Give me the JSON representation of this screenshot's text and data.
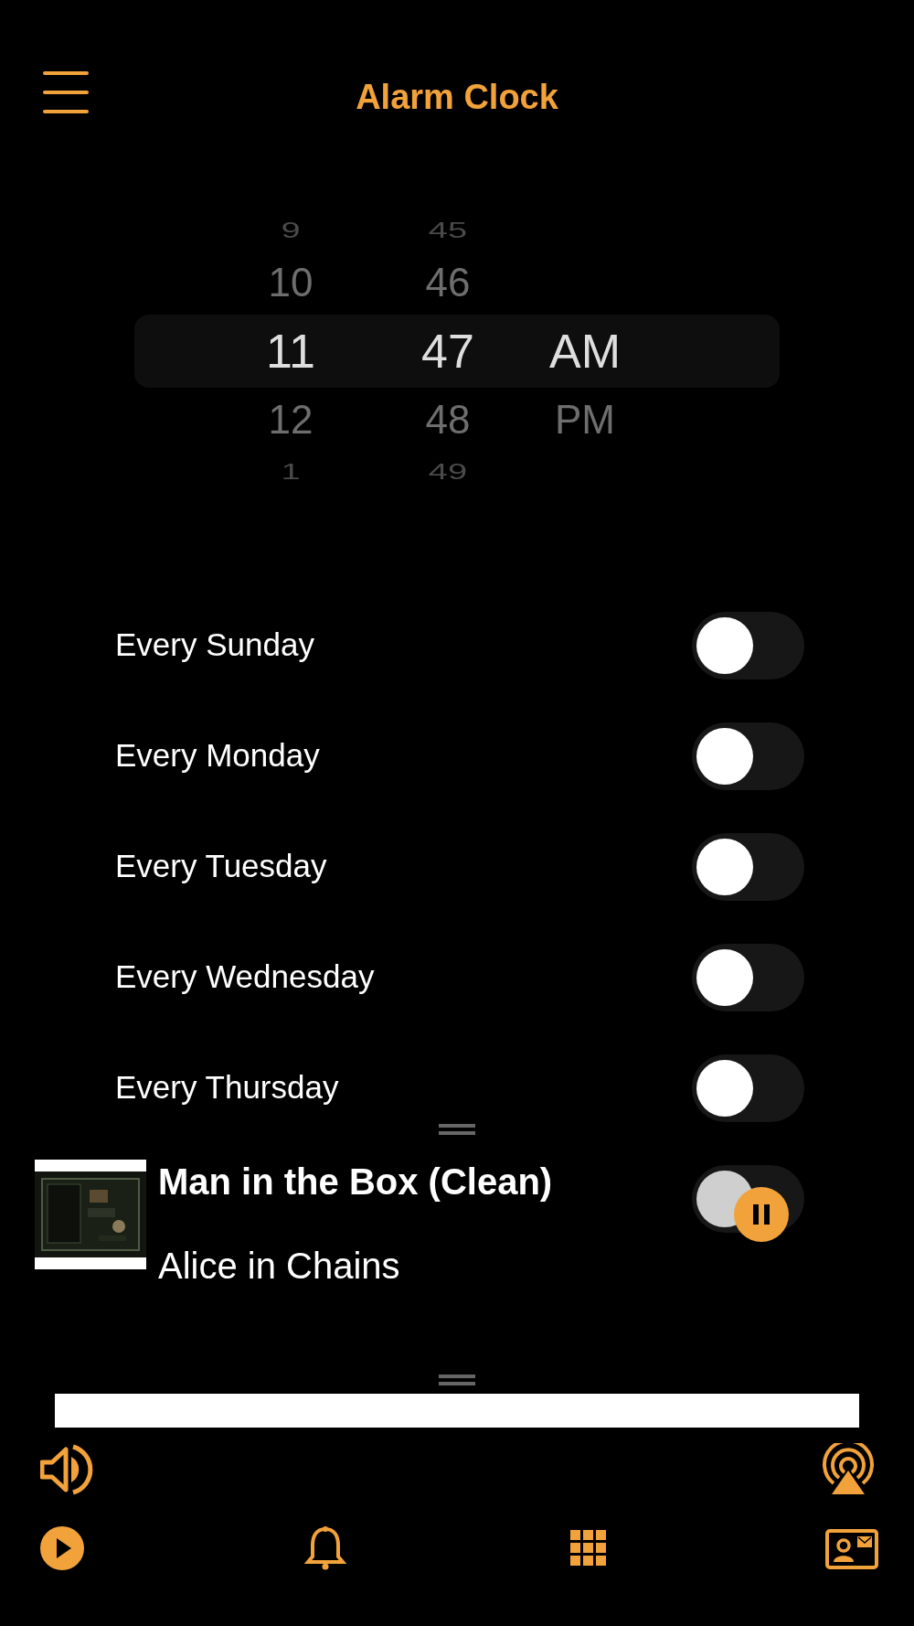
{
  "header": {
    "title": "Alarm Clock"
  },
  "picker": {
    "columns": [
      {
        "items": [
          {
            "text": "9",
            "selected": false
          },
          {
            "text": "10",
            "selected": false
          },
          {
            "text": "11",
            "selected": true
          },
          {
            "text": "12",
            "selected": false
          },
          {
            "text": "1",
            "selected": false
          }
        ]
      },
      {
        "items": [
          {
            "text": "45",
            "selected": false
          },
          {
            "text": "46",
            "selected": false
          },
          {
            "text": "47",
            "selected": true
          },
          {
            "text": "48",
            "selected": false
          },
          {
            "text": "49",
            "selected": false
          }
        ]
      },
      {
        "items": [
          {
            "text": "AM",
            "selected": true
          },
          {
            "text": "PM",
            "selected": false
          }
        ]
      }
    ]
  },
  "repeat_days": [
    {
      "label": "Every Sunday",
      "on": false
    },
    {
      "label": "Every Monday",
      "on": false
    },
    {
      "label": "Every Tuesday",
      "on": false
    },
    {
      "label": "Every Wednesday",
      "on": false
    },
    {
      "label": "Every Thursday",
      "on": false
    },
    {
      "on": false,
      "dimmed": true
    }
  ],
  "now_playing": {
    "title": "Man in the Box (Clean)",
    "artist": "Alice in Chains",
    "playing": true
  },
  "volume": {
    "level": 1
  },
  "tab_bar": [
    {
      "kind": "play"
    },
    {
      "kind": "alarm"
    },
    {
      "kind": "grid"
    },
    {
      "kind": "contact"
    }
  ]
}
